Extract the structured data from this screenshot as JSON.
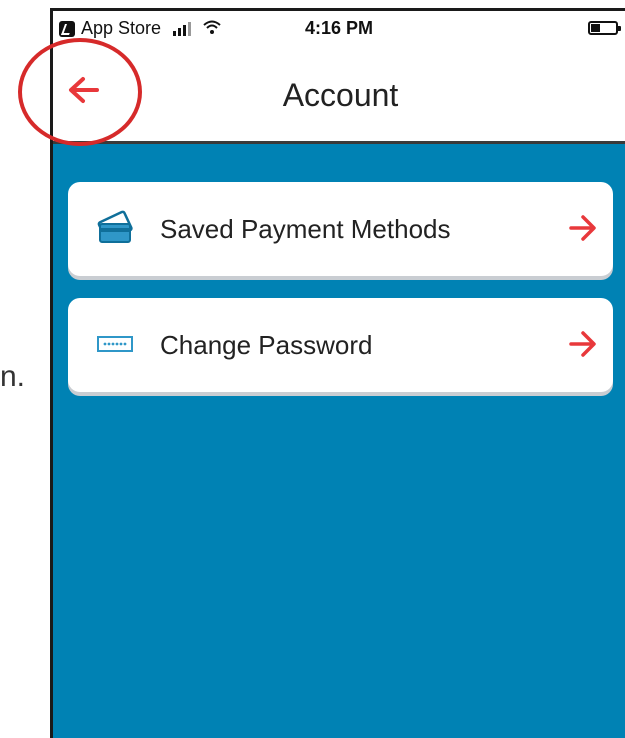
{
  "stray_text": "n.",
  "status_bar": {
    "carrier": "App Store",
    "time": "4:16 PM"
  },
  "nav": {
    "title": "Account",
    "back_icon": "back-arrow-icon"
  },
  "menu": {
    "items": [
      {
        "label": "Saved Payment Methods",
        "icon": "credit-card-icon",
        "arrow_icon": "chevron-right-icon"
      },
      {
        "label": "Change Password",
        "icon": "password-field-icon",
        "arrow_icon": "chevron-right-icon"
      }
    ]
  },
  "colors": {
    "accent": "#e8383b",
    "background": "#0082b4",
    "card": "#ffffff",
    "annotation": "#d62a2a"
  }
}
